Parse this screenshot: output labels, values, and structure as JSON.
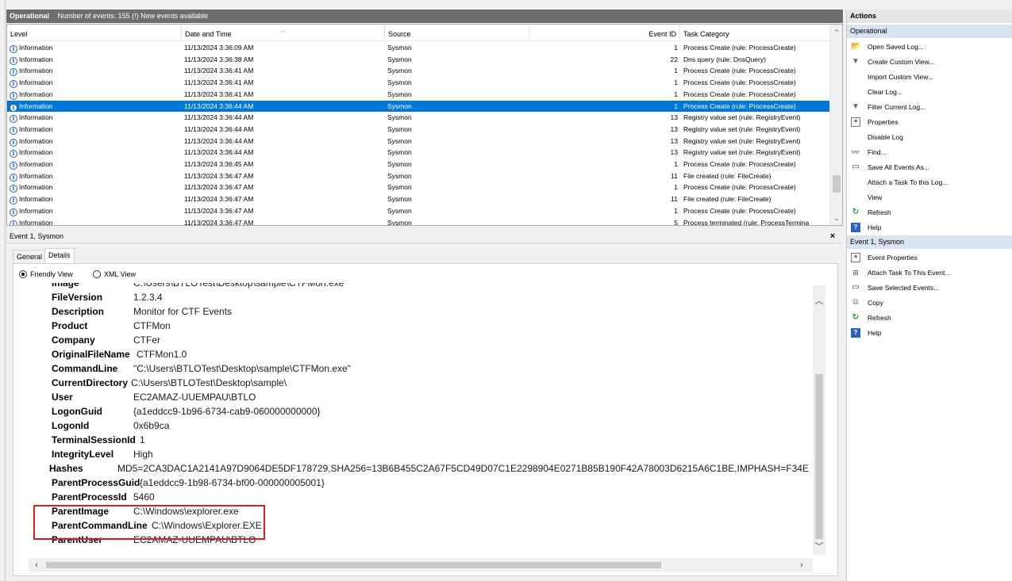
{
  "log_header": {
    "name": "Operational",
    "info": "Number of events: 155 (!) New events available"
  },
  "grid": {
    "columns": [
      "Level",
      "Date and Time",
      "Source",
      "Event ID",
      "Task Category"
    ],
    "rows": [
      {
        "level": "Information",
        "datetime": "11/13/2024 3:36:09 AM",
        "source": "Sysmon",
        "event_id": "1",
        "category": "Process Create (rule: ProcessCreate)"
      },
      {
        "level": "Information",
        "datetime": "11/13/2024 3:36:38 AM",
        "source": "Sysmon",
        "event_id": "22",
        "category": "Dns query (rule: DnsQuery)"
      },
      {
        "level": "Information",
        "datetime": "11/13/2024 3:36:41 AM",
        "source": "Sysmon",
        "event_id": "1",
        "category": "Process Create (rule: ProcessCreate)"
      },
      {
        "level": "Information",
        "datetime": "11/13/2024 3:36:41 AM",
        "source": "Sysmon",
        "event_id": "1",
        "category": "Process Create (rule: ProcessCreate)"
      },
      {
        "level": "Information",
        "datetime": "11/13/2024 3:36:41 AM",
        "source": "Sysmon",
        "event_id": "1",
        "category": "Process Create (rule: ProcessCreate)"
      },
      {
        "level": "Information",
        "datetime": "11/13/2024 3:36:44 AM",
        "source": "Sysmon",
        "event_id": "1",
        "category": "Process Create (rule: ProcessCreate)"
      },
      {
        "level": "Information",
        "datetime": "11/13/2024 3:36:44 AM",
        "source": "Sysmon",
        "event_id": "13",
        "category": "Registry value set (rule: RegistryEvent)"
      },
      {
        "level": "Information",
        "datetime": "11/13/2024 3:36:44 AM",
        "source": "Sysmon",
        "event_id": "13",
        "category": "Registry value set (rule: RegistryEvent)"
      },
      {
        "level": "Information",
        "datetime": "11/13/2024 3:36:44 AM",
        "source": "Sysmon",
        "event_id": "13",
        "category": "Registry value set (rule: RegistryEvent)"
      },
      {
        "level": "Information",
        "datetime": "11/13/2024 3:36:44 AM",
        "source": "Sysmon",
        "event_id": "13",
        "category": "Registry value set (rule: RegistryEvent)"
      },
      {
        "level": "Information",
        "datetime": "11/13/2024 3:36:45 AM",
        "source": "Sysmon",
        "event_id": "1",
        "category": "Process Create (rule: ProcessCreate)"
      },
      {
        "level": "Information",
        "datetime": "11/13/2024 3:36:47 AM",
        "source": "Sysmon",
        "event_id": "11",
        "category": "File created (rule: FileCreate)"
      },
      {
        "level": "Information",
        "datetime": "11/13/2024 3:36:47 AM",
        "source": "Sysmon",
        "event_id": "1",
        "category": "Process Create (rule: ProcessCreate)"
      },
      {
        "level": "Information",
        "datetime": "11/13/2024 3:36:47 AM",
        "source": "Sysmon",
        "event_id": "11",
        "category": "File created (rule: FileCreate)"
      },
      {
        "level": "Information",
        "datetime": "11/13/2024 3:36:47 AM",
        "source": "Sysmon",
        "event_id": "1",
        "category": "Process Create (rule: ProcessCreate)"
      },
      {
        "level": "Information",
        "datetime": "11/13/2024 3:36:47 AM",
        "source": "Sysmon",
        "event_id": "5",
        "category": "Process terminated (rule: ProcessTermina"
      }
    ],
    "selected_row": 5
  },
  "detail": {
    "title": "Event 1, Sysmon",
    "close": "×",
    "tabs": [
      "General",
      "Details"
    ],
    "active_tab": 1,
    "view_options": [
      "Friendly View",
      "XML View"
    ],
    "selected_view": 0,
    "properties": [
      {
        "key": "Image",
        "value": "C:\\Users\\BTLOTest\\Desktop\\sample\\CTFMon.exe"
      },
      {
        "key": "FileVersion",
        "value": "1.2.3.4"
      },
      {
        "key": "Description",
        "value": "Monitor for CTF Events"
      },
      {
        "key": "Product",
        "value": "CTFMon"
      },
      {
        "key": "Company",
        "value": "CTFer"
      },
      {
        "key": "OriginalFileName",
        "value": "CTFMon1.0"
      },
      {
        "key": "CommandLine",
        "value": "\"C:\\Users\\BTLOTest\\Desktop\\sample\\CTFMon.exe\""
      },
      {
        "key": "CurrentDirectory",
        "value": "C:\\Users\\BTLOTest\\Desktop\\sample\\"
      },
      {
        "key": "User",
        "value": "EC2AMAZ-UUEMPAU\\BTLO"
      },
      {
        "key": "LogonGuid",
        "value": "{a1eddcc9-1b96-6734-cab9-060000000000}"
      },
      {
        "key": "LogonId",
        "value": "0x6b9ca"
      },
      {
        "key": "TerminalSessionId",
        "value": "1"
      },
      {
        "key": "IntegrityLevel",
        "value": "High"
      },
      {
        "key": "Hashes",
        "value": "MD5=2CA3DAC1A2141A97D9064DE5DF178729,SHA256=13B6B455C2A67F5CD49D07C1E2298904E0271B85B190F42A78003D6215A6C1BE,IMPHASH=F34E"
      },
      {
        "key": "ParentProcessGuid",
        "value": "{a1eddcc9-1b98-6734-bf00-000000005001}"
      },
      {
        "key": "ParentProcessId",
        "value": "5460"
      },
      {
        "key": "ParentImage",
        "value": "C:\\Windows\\explorer.exe"
      },
      {
        "key": "ParentCommandLine",
        "value": "C:\\Windows\\Explorer.EXE"
      },
      {
        "key": "ParentUser",
        "value": "EC2AMAZ-UUEMPAU\\BTLO"
      }
    ]
  },
  "actions": {
    "title": "Actions",
    "sections": [
      {
        "title": "Operational",
        "items": [
          {
            "label": "Open Saved Log...",
            "icon": "folder-icon"
          },
          {
            "label": "Create Custom View...",
            "icon": "filter-icon"
          },
          {
            "label": "Import Custom View...",
            "icon": ""
          },
          {
            "label": "Clear Log...",
            "icon": ""
          },
          {
            "label": "Filter Current Log...",
            "icon": "filter-icon"
          },
          {
            "label": "Properties",
            "icon": "properties-icon"
          },
          {
            "label": "Disable Log",
            "icon": ""
          },
          {
            "label": "Find...",
            "icon": "find-icon"
          },
          {
            "label": "Save All Events As...",
            "icon": "save-icon"
          },
          {
            "label": "Attach a Task To this Log...",
            "icon": ""
          },
          {
            "label": "View",
            "icon": ""
          },
          {
            "label": "Refresh",
            "icon": "refresh-icon"
          },
          {
            "label": "Help",
            "icon": "help-icon"
          }
        ]
      },
      {
        "title": "Event 1, Sysmon",
        "items": [
          {
            "label": "Event Properties",
            "icon": "event-properties-icon"
          },
          {
            "label": "Attach Task To This Event...",
            "icon": "task-icon"
          },
          {
            "label": "Save Selected Events...",
            "icon": "save-icon"
          },
          {
            "label": "Copy",
            "icon": "copy-icon"
          },
          {
            "label": "Refresh",
            "icon": "refresh-icon"
          },
          {
            "label": "Help",
            "icon": "help-icon"
          }
        ]
      }
    ]
  },
  "colors": {
    "selection": "#0078d7",
    "header_bar": "#6d6d6d",
    "highlight_box": "#d32020"
  }
}
